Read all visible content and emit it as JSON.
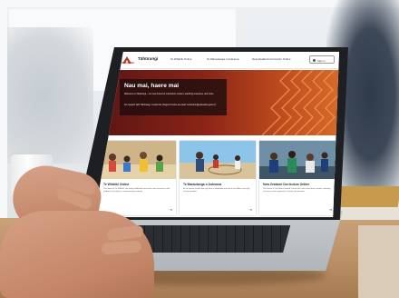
{
  "site": {
    "logo_text": "Te Poutāhū",
    "brand": "Tāhūrangi",
    "nav": [
      "Te Whāriki Online",
      "Te Marautanga o Aotearoa",
      "New Zealand Curriculum Online"
    ],
    "sign_in": "Sign in"
  },
  "hero": {
    "title": "Nau mai, haere mai",
    "intro": "Welcome to Tāhūrangi – our new home for curriculum content, teaching resources, and more.",
    "note": "For support with Tāhūrangi, contact the Support Centre at email: curriculum@education.govt.nz"
  },
  "cards": [
    {
      "title": "Te Whāriki Online",
      "text": "The home of Te Whāriki, the early childhood curriculum, with resources and guidance for kaiako in early learning settings.",
      "arrow": "➜"
    },
    {
      "title": "Te Marautanga o Aotearoa",
      "text": "Ko te marau ā-motu mō ngā kura e whakaako ana mā te reo Māori, me ngā rauemi tautoko.",
      "arrow": "➜"
    },
    {
      "title": "New Zealand Curriculum Online",
      "text": "The home of The New Zealand Curriculum, with curriculum content, teaching resources and support for schools and teachers.",
      "arrow": "➜"
    }
  ],
  "colors": {
    "hero_dark": "#5a1413",
    "hero_light": "#d66a2a",
    "accent": "#b03a22"
  }
}
